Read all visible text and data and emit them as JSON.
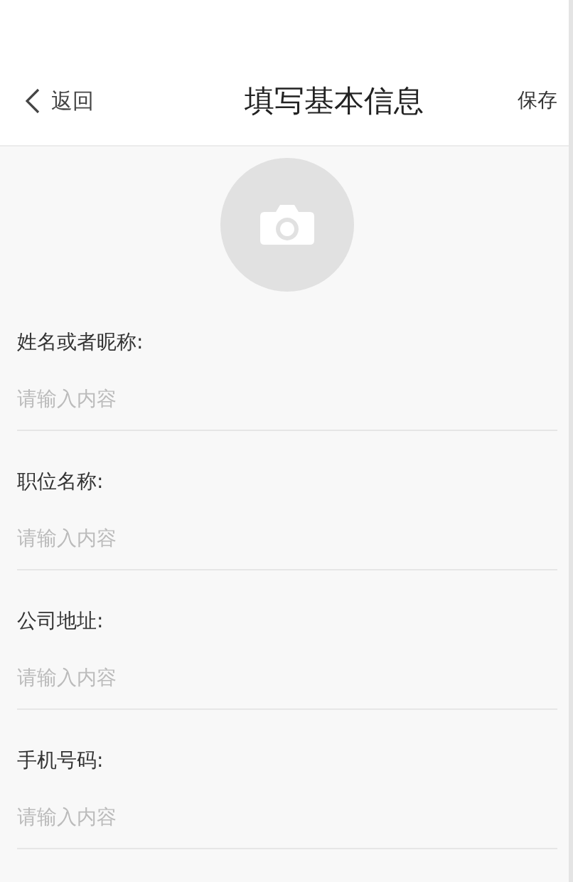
{
  "header": {
    "back_label": "返回",
    "title": "填写基本信息",
    "save_label": "保存"
  },
  "fields": [
    {
      "label": "姓名或者昵称:",
      "placeholder": "请输入内容"
    },
    {
      "label": "职位名称:",
      "placeholder": "请输入内容"
    },
    {
      "label": "公司地址:",
      "placeholder": "请输入内容"
    },
    {
      "label": "手机号码:",
      "placeholder": "请输入内容"
    }
  ]
}
